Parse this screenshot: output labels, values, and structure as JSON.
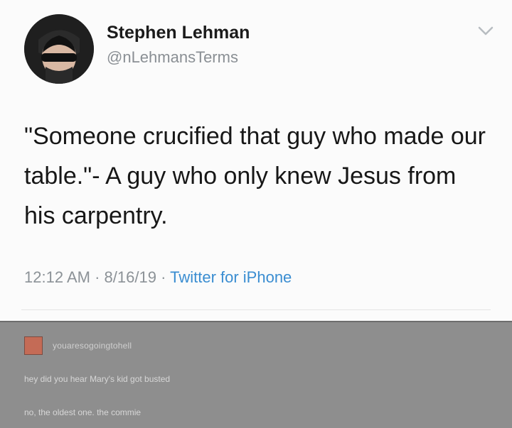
{
  "tweet": {
    "display_name": "Stephen Lehman",
    "handle": "@nLehmansTerms",
    "text": "\"Someone crucified that guy who made our table.\"- A guy who only knew Jesus from his carpentry.",
    "time": "12:12 AM",
    "date": "8/16/19",
    "source": "Twitter for iPhone",
    "separator": "·",
    "avatar_icon": "avatar-icon",
    "menu_icon": "chevron-down-icon"
  },
  "reply_thread": {
    "username": "youaresogoingtohell",
    "lines": [
      "hey did you hear Mary's kid got busted",
      "no, the oldest one. the commie"
    ]
  },
  "colors": {
    "link": "#3a8dd1",
    "meta": "#8c9297",
    "reply_background": "#8e8e8e"
  }
}
